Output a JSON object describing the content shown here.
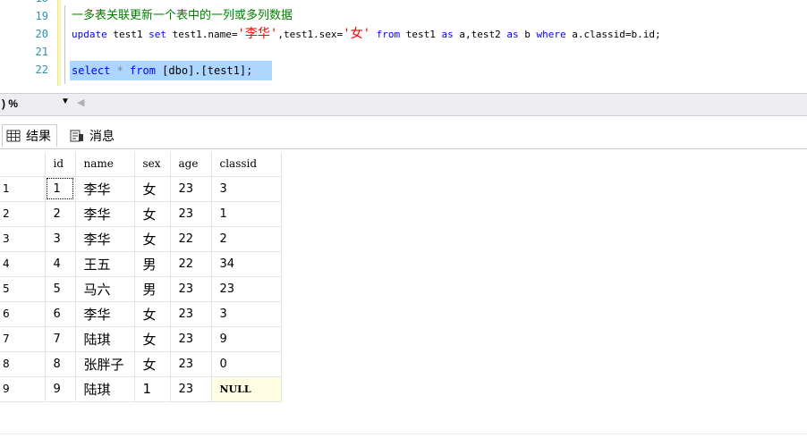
{
  "editor": {
    "lines": [
      {
        "num": "19",
        "comment": "一多表关联更新一个表中的一列或多列数据"
      },
      {
        "num": "20",
        "t_update": "update",
        "t_test1": " test1 ",
        "t_set": "set",
        "t_a1": " test1.name=",
        "t_s1": "'李华'",
        "t_a2": ",test1.sex=",
        "t_s2": "'女'",
        "t_from": "from",
        "t_a3": " test1 ",
        "t_as1": "as",
        "t_a4": " a,test2 ",
        "t_as2": "as",
        "t_a5": " b ",
        "t_where": "where",
        "t_a6": " a.classid=b.id;"
      },
      {
        "num": "21"
      },
      {
        "num": "22",
        "t_select": "select",
        "t_star": " * ",
        "t_from": "from",
        "t_rest": " [dbo].[test1];"
      }
    ]
  },
  "zoom": {
    "value": ") %",
    "dropdown_icon": "▼",
    "scroll_icon": "◀"
  },
  "tabs": {
    "results_label": "结果",
    "messages_label": "消息"
  },
  "grid": {
    "headers": [
      "id",
      "name",
      "sex",
      "age",
      "classid"
    ],
    "rows": [
      {
        "rownum": "1",
        "id": "1",
        "name": "李华",
        "sex": "女",
        "age": "23",
        "classid": "3"
      },
      {
        "rownum": "2",
        "id": "2",
        "name": "李华",
        "sex": "女",
        "age": "23",
        "classid": "1"
      },
      {
        "rownum": "3",
        "id": "3",
        "name": "李华",
        "sex": "女",
        "age": "22",
        "classid": "2"
      },
      {
        "rownum": "4",
        "id": "4",
        "name": "王五",
        "sex": "男",
        "age": "22",
        "classid": "34"
      },
      {
        "rownum": "5",
        "id": "5",
        "name": "马六",
        "sex": "男",
        "age": "23",
        "classid": "23"
      },
      {
        "rownum": "6",
        "id": "6",
        "name": "李华",
        "sex": "女",
        "age": "23",
        "classid": "3"
      },
      {
        "rownum": "7",
        "id": "7",
        "name": "陆琪",
        "sex": "女",
        "age": "23",
        "classid": "9"
      },
      {
        "rownum": "8",
        "id": "8",
        "name": "张胖子",
        "sex": "女",
        "age": "23",
        "classid": "0"
      },
      {
        "rownum": "9",
        "id": "9",
        "name": "陆琪",
        "sex": "1",
        "age": "23",
        "classid": "NULL"
      }
    ]
  },
  "colors": {
    "keyword": "#0000ff",
    "string": "#ff0000",
    "comment": "#008000",
    "line_number": "#2b91af",
    "selection": "#add6ff",
    "null_cell": "#fffde1"
  }
}
